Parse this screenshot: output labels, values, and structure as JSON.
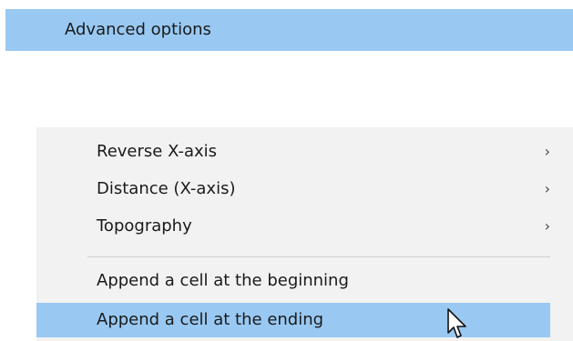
{
  "menu": {
    "parent_item": {
      "label": "Advanced options",
      "chevron": "›"
    },
    "submenu": {
      "items": [
        {
          "label": "Reverse X-axis",
          "chevron": "›"
        },
        {
          "label": "Distance (X-axis)",
          "chevron": "›"
        },
        {
          "label": "Topography",
          "chevron": "›"
        },
        {
          "label": "Append a cell at the beginning",
          "chevron": ""
        },
        {
          "label": "Append a cell at the ending",
          "chevron": "",
          "highlighted": true
        }
      ]
    }
  },
  "colors": {
    "highlight": "#99c9f3",
    "menu_background": "#f2f2f2",
    "separator": "#cfcfcf"
  },
  "icons": {
    "chevron": "chevron-right-icon",
    "cursor": "mouse-pointer-icon"
  }
}
